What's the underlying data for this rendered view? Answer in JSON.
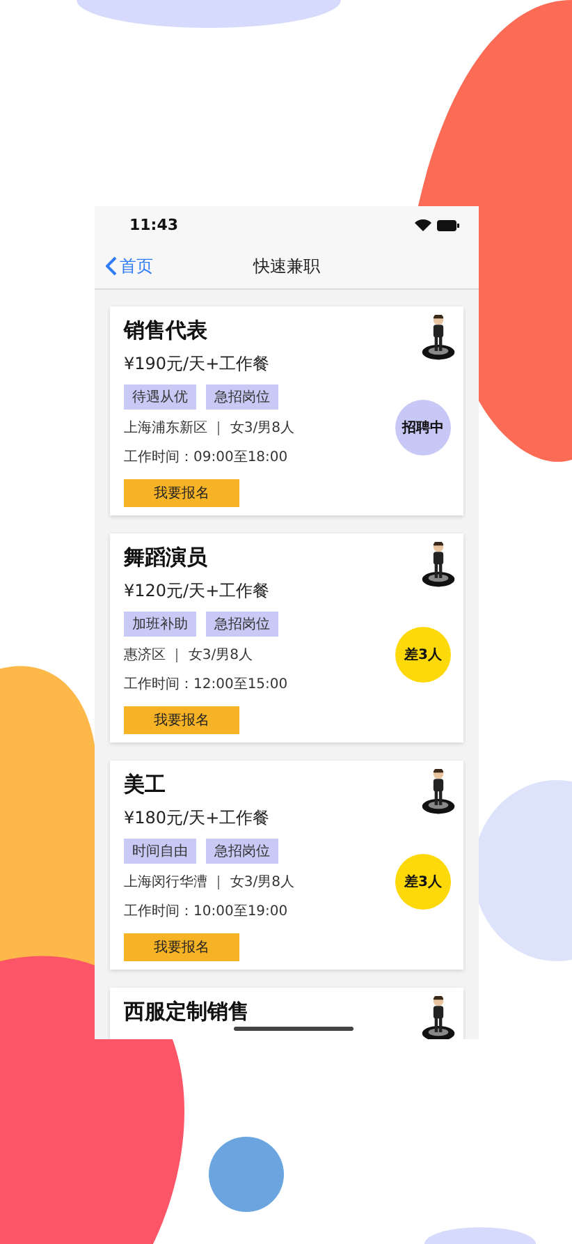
{
  "status_bar": {
    "time": "11:43"
  },
  "nav": {
    "back_label": "首页",
    "title": "快速兼职"
  },
  "jobs": [
    {
      "title": "销售代表",
      "salary": "¥190元/天+工作餐",
      "tags": [
        "待遇从优",
        "急招岗位"
      ],
      "location": "上海浦东新区 ｜ 女3/男8人",
      "hours": "工作时间：09:00至18:00",
      "badge": {
        "text": "招聘中",
        "color": "#c8c8f6"
      },
      "button": "我要报名"
    },
    {
      "title": "舞蹈演员",
      "salary": "¥120元/天+工作餐",
      "tags": [
        "加班补助",
        "急招岗位"
      ],
      "location": "惠济区 ｜ 女3/男8人",
      "hours": "工作时间：12:00至15:00",
      "badge": {
        "text": "差3人",
        "color": "#fdd90a"
      },
      "button": "我要报名"
    },
    {
      "title": "美工",
      "salary": "¥180元/天+工作餐",
      "tags": [
        "时间自由",
        "急招岗位"
      ],
      "location": "上海闵行华漕 ｜ 女3/男8人",
      "hours": "工作时间：10:00至19:00",
      "badge": {
        "text": "差3人",
        "color": "#fdd90a"
      },
      "button": "我要报名"
    },
    {
      "title": "西服定制销售"
    }
  ]
}
